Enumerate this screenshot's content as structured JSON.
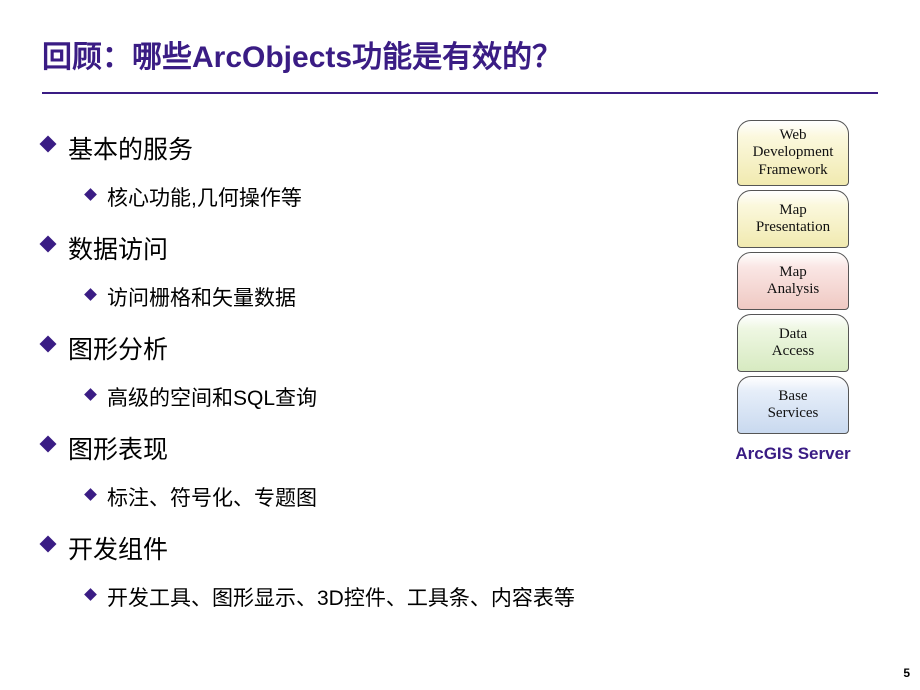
{
  "title": "回顾：哪些ArcObjects功能是有效的？",
  "bullets": [
    {
      "l1": "基本的服务",
      "l2": "核心功能,几何操作等"
    },
    {
      "l1": "数据访问",
      "l2": "访问栅格和矢量数据"
    },
    {
      "l1": "图形分析",
      "l2": "高级的空间和SQL查询"
    },
    {
      "l1": "图形表现",
      "l2": "标注、符号化、专题图"
    },
    {
      "l1": "开发组件",
      "l2": "开发工具、图形显示、3D控件、工具条、内容表等"
    }
  ],
  "stack": {
    "items": [
      {
        "label": "Web\nDevelopment\nFramework",
        "color": "yellow",
        "lines": 3
      },
      {
        "label": "Map\nPresentation",
        "color": "yellow",
        "lines": 2
      },
      {
        "label": "Map\nAnalysis",
        "color": "pink",
        "lines": 2
      },
      {
        "label": "Data\nAccess",
        "color": "green",
        "lines": 2
      },
      {
        "label": "Base\nServices",
        "color": "blue",
        "lines": 2
      }
    ],
    "caption": "ArcGIS Server"
  },
  "page": "5"
}
